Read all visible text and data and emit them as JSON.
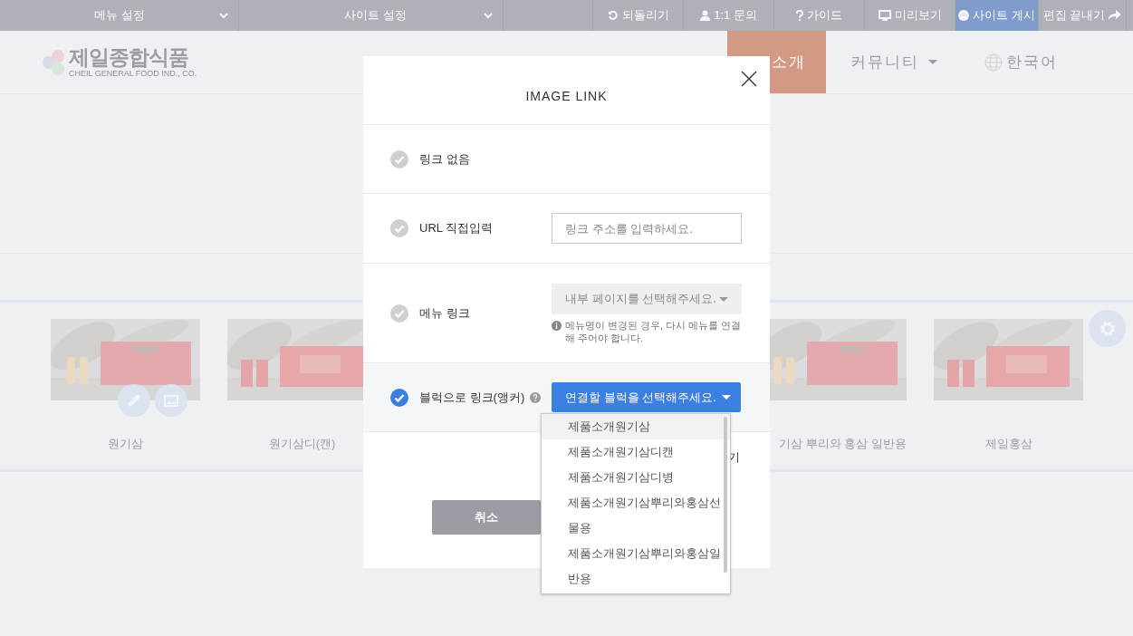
{
  "toolbar": {
    "menus": [
      {
        "label": "메뉴 설정"
      },
      {
        "label": "사이트 설정"
      }
    ],
    "buttons": [
      {
        "label": "되돌리기",
        "highlighted": false
      },
      {
        "label": "1:1 문의",
        "highlighted": false
      },
      {
        "label": "가이드",
        "highlighted": false
      },
      {
        "label": "미리보기",
        "highlighted": false
      },
      {
        "label": "사이트 게시",
        "highlighted": true
      },
      {
        "label": "편집 끝내기",
        "highlighted": false
      }
    ]
  },
  "header": {
    "logo": {
      "name": "제일종합식품",
      "subtitle": "CHEIL GENERAL FOOD IND., CO."
    },
    "nav": [
      {
        "label": "소개",
        "selected": true
      },
      {
        "label": "커뮤니티",
        "selected": false
      }
    ],
    "language": "한국어"
  },
  "products": [
    {
      "name": "원기삼",
      "tools": true
    },
    {
      "name": "원기삼디(캔)",
      "tools": false
    },
    {
      "name": "기삼 뿌리와 홍삼 일반용",
      "tools": false
    },
    {
      "name": "제일홍삼",
      "tools": false
    }
  ],
  "modal": {
    "title": "IMAGE LINK",
    "rows": [
      {
        "kind": "plain",
        "label": "링크 없음",
        "selected": false
      },
      {
        "kind": "input",
        "label": "URL 직접입력",
        "selected": false,
        "placeholder": "링크 주소를 입력하세요."
      },
      {
        "kind": "select",
        "label": "메뉴 링크",
        "selected": false,
        "value": "내부 페이지를 선택해주세요.",
        "note": "메뉴명이 변경된 경우, 다시 메뉴를 연결해 주어야 합니다."
      },
      {
        "kind": "anchor",
        "label": "블럭으로 링크(앵커)",
        "selected": true,
        "value": "연결할 블럭을 선택해주세요."
      }
    ],
    "option_tail": "기",
    "cancel": "취소",
    "dropdown": [
      {
        "label": "제품소개원기삼",
        "selected": true
      },
      {
        "label": "제품소개원기삼디캔",
        "selected": false
      },
      {
        "label": "제품소개원기삼디병",
        "selected": false
      },
      {
        "label": "제품소개원기삼뿌리와홍삼선물용",
        "selected": false
      },
      {
        "label": "제품소개원기삼뿌리와홍삼일반용",
        "selected": false
      }
    ]
  }
}
